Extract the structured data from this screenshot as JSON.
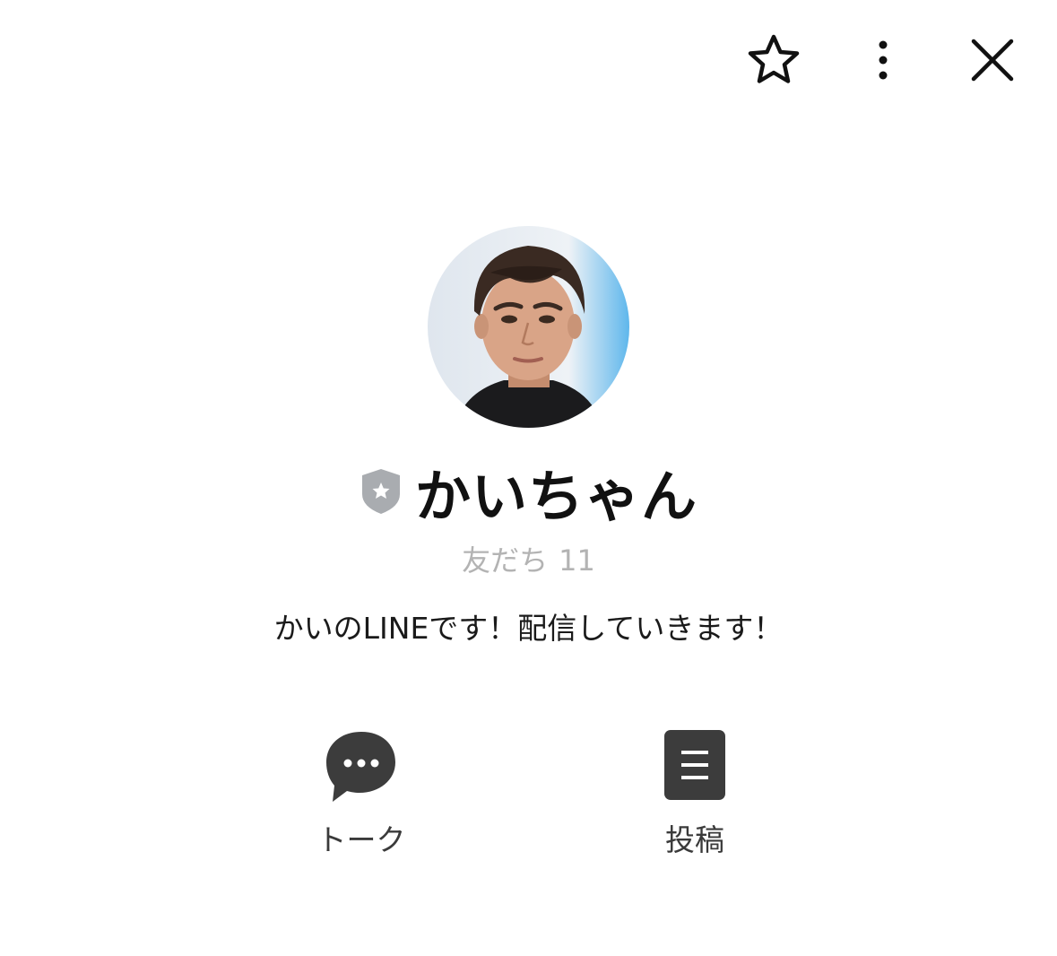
{
  "header": {
    "icons": [
      "star-outline-icon",
      "vertical-dots-icon",
      "close-x-icon"
    ]
  },
  "profile": {
    "display_name": "かいちゃん",
    "badge_icon": "shield-star-icon",
    "friends_label": "友だち",
    "friends_count": "11",
    "status_message": "かいのLINEです！配信していきます！"
  },
  "actions": [
    {
      "label": "トーク",
      "icon": "chat-bubble-icon"
    },
    {
      "label": "投稿",
      "icon": "post-document-icon"
    }
  ],
  "colors": {
    "icon_dark": "#3c3c3c",
    "badge_gray": "#a9acb0",
    "subtext_gray": "#b3b3b3"
  }
}
